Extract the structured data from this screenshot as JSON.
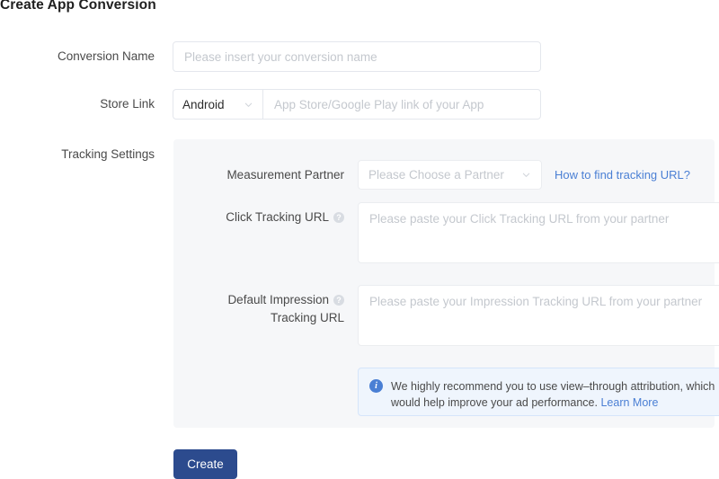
{
  "page": {
    "title": "Create App Conversion"
  },
  "form": {
    "conversion_name": {
      "label": "Conversion Name",
      "placeholder": "Please insert your conversion name",
      "value": ""
    },
    "store_link": {
      "label": "Store Link",
      "platform_value": "Android",
      "url_placeholder": "App Store/Google Play link of your App",
      "url_value": ""
    },
    "tracking_settings": {
      "label": "Tracking Settings",
      "measurement_partner": {
        "label": "Measurement Partner",
        "placeholder": "Please Choose a Partner",
        "value": "",
        "help_link": "How to find tracking URL?"
      },
      "click_tracking_url": {
        "label": "Click Tracking URL",
        "help_icon": "question-mark-icon",
        "placeholder": "Please paste your Click Tracking URL from your partner",
        "value": ""
      },
      "impression_tracking_url": {
        "label_line1": "Default Impression",
        "label_line2": "Tracking URL",
        "help_icon": "question-mark-icon",
        "placeholder": "Please paste your Impression Tracking URL from your partner",
        "value": ""
      },
      "notice": {
        "icon": "info-circle-icon",
        "text": "We highly recommend you to use view–through attribution, which would help improve your ad performance. ",
        "link_label": "Learn More"
      }
    },
    "submit_button": "Create"
  },
  "colors": {
    "link_blue": "#4a7fd4",
    "button_navy": "#2c4b8e",
    "panel_bg": "#f6f7f9",
    "notice_bg": "#eff5fd",
    "placeholder_grey": "#c4c8ce"
  }
}
